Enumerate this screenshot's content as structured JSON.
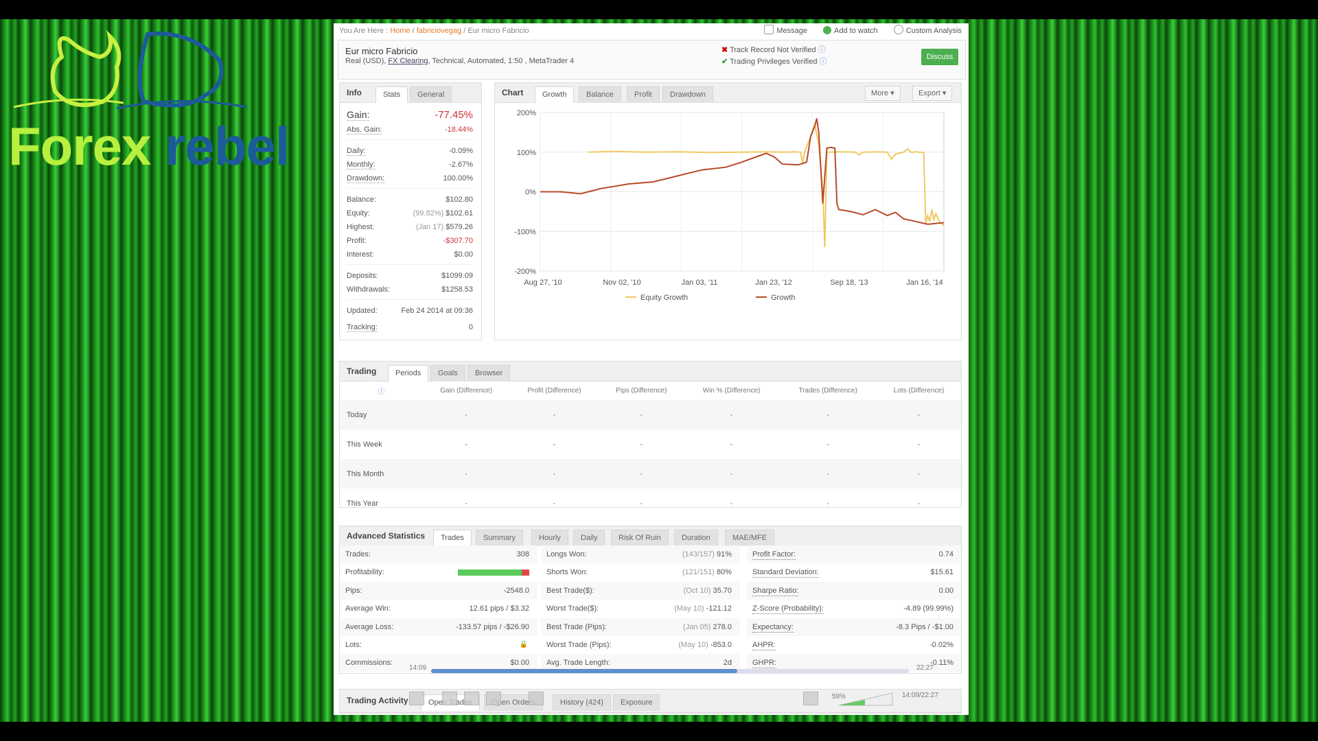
{
  "logo": {
    "word1": "Forex",
    "word2": "rebel"
  },
  "breadcrumb": {
    "prefix": "You Are Here :",
    "home": "Home",
    "user": "fabriciovegag",
    "current": "Eur micro Fabricio",
    "sep": "/"
  },
  "top_actions": {
    "message": "Message",
    "watch": "Add to watch",
    "custom": "Custom Analysis"
  },
  "account": {
    "name": "Eur micro Fabricio",
    "sub_a": "Real (USD),",
    "broker": "FX Clearing",
    "sub_b": ", Technical, Automated, 1:50 , MetaTrader 4",
    "track_record": "Track Record Not Verified",
    "privileges": "Trading Privileges Verified",
    "discuss": "Discuss"
  },
  "info_panel": {
    "tabs": [
      "Info",
      "Stats",
      "General"
    ],
    "gain_label": "Gain:",
    "gain_value": "-77.45%",
    "abs_gain_label": "Abs. Gain:",
    "abs_gain_value": "-18.44%",
    "daily_label": "Daily:",
    "daily_value": "-0.09%",
    "monthly_label": "Monthly:",
    "monthly_value": "-2.67%",
    "drawdown_label": "Drawdown:",
    "drawdown_value": "100.00%",
    "balance_label": "Balance:",
    "balance_value": "$102.80",
    "equity_label": "Equity:",
    "equity_pct": "(99.82%)",
    "equity_value": "$102.61",
    "highest_label": "Highest:",
    "highest_date": "(Jan 17)",
    "highest_value": "$579.26",
    "profit_label": "Profit:",
    "profit_value": "-$307.70",
    "interest_label": "Interest:",
    "interest_value": "$0.00",
    "deposits_label": "Deposits:",
    "deposits_value": "$1099.09",
    "withdrawals_label": "Withdrawals:",
    "withdrawals_value": "$1258.53",
    "updated_label": "Updated:",
    "updated_value": "Feb 24 2014 at 09:36",
    "tracking_label": "Tracking:",
    "tracking_value": "0"
  },
  "chart_panel": {
    "title": "Chart",
    "tabs": [
      "Growth",
      "Balance",
      "Profit",
      "Drawdown"
    ],
    "more": "More",
    "export": "Export"
  },
  "chart_data": {
    "type": "line",
    "ylim": [
      -200,
      200
    ],
    "y_ticks": [
      "200%",
      "100%",
      "0%",
      "-100%",
      "-200%"
    ],
    "x_ticks": [
      "Aug 27, '10",
      "Nov 02, '10",
      "Jan 03, '11",
      "Jan 23, '12",
      "Sep 18, '13",
      "Jan 16, '14"
    ],
    "grid": true,
    "legend_position": "bottom",
    "series": [
      {
        "name": "Equity Growth",
        "color": "#f0c860",
        "points": [
          [
            0.12,
            100
          ],
          [
            0.18,
            102
          ],
          [
            0.26,
            100
          ],
          [
            0.34,
            101
          ],
          [
            0.42,
            99
          ],
          [
            0.5,
            100
          ],
          [
            0.56,
            101
          ],
          [
            0.6,
            100
          ],
          [
            0.63,
            101
          ],
          [
            0.645,
            100
          ],
          [
            0.65,
            72
          ],
          [
            0.655,
            100
          ],
          [
            0.67,
            140
          ],
          [
            0.68,
            170
          ],
          [
            0.69,
            120
          ],
          [
            0.7,
            0
          ],
          [
            0.705,
            -140
          ],
          [
            0.71,
            100
          ],
          [
            0.75,
            101
          ],
          [
            0.78,
            100
          ],
          [
            0.79,
            93
          ],
          [
            0.8,
            100
          ],
          [
            0.83,
            101
          ],
          [
            0.86,
            100
          ],
          [
            0.87,
            82
          ],
          [
            0.88,
            95
          ],
          [
            0.9,
            100
          ],
          [
            0.91,
            108
          ],
          [
            0.92,
            99
          ],
          [
            0.93,
            101
          ],
          [
            0.95,
            99
          ],
          [
            0.955,
            -80
          ],
          [
            0.96,
            -60
          ],
          [
            0.965,
            -75
          ],
          [
            0.97,
            -45
          ],
          [
            0.975,
            -70
          ],
          [
            0.98,
            -55
          ],
          [
            0.99,
            -78
          ],
          [
            1.0,
            -85
          ]
        ]
      },
      {
        "name": "Growth",
        "color": "#b84a28",
        "points": [
          [
            0.0,
            0
          ],
          [
            0.05,
            0
          ],
          [
            0.1,
            -5
          ],
          [
            0.15,
            8
          ],
          [
            0.22,
            20
          ],
          [
            0.28,
            25
          ],
          [
            0.34,
            40
          ],
          [
            0.4,
            55
          ],
          [
            0.46,
            62
          ],
          [
            0.5,
            75
          ],
          [
            0.54,
            90
          ],
          [
            0.56,
            97
          ],
          [
            0.58,
            88
          ],
          [
            0.6,
            70
          ],
          [
            0.64,
            68
          ],
          [
            0.66,
            75
          ],
          [
            0.67,
            140
          ],
          [
            0.68,
            165
          ],
          [
            0.685,
            185
          ],
          [
            0.69,
            150
          ],
          [
            0.7,
            -30
          ],
          [
            0.71,
            110
          ],
          [
            0.72,
            112
          ],
          [
            0.73,
            110
          ],
          [
            0.735,
            -30
          ],
          [
            0.74,
            -45
          ],
          [
            0.77,
            -50
          ],
          [
            0.8,
            -58
          ],
          [
            0.83,
            -45
          ],
          [
            0.86,
            -60
          ],
          [
            0.88,
            -52
          ],
          [
            0.9,
            -68
          ],
          [
            0.93,
            -75
          ],
          [
            0.96,
            -82
          ],
          [
            1.0,
            -78
          ]
        ]
      }
    ]
  },
  "trading": {
    "title": "Trading",
    "tabs": [
      "Periods",
      "Goals",
      "Browser"
    ],
    "headers": [
      "Gain (Difference)",
      "Profit (Difference)",
      "Pips (Difference)",
      "Win % (Difference)",
      "Trades (Difference)",
      "Lots (Difference)"
    ],
    "rows": [
      {
        "label": "Today",
        "cells": [
          "-",
          "-",
          "-",
          "-",
          "-",
          "-"
        ]
      },
      {
        "label": "This Week",
        "cells": [
          "-",
          "-",
          "-",
          "-",
          "-",
          "-"
        ]
      },
      {
        "label": "This Month",
        "cells": [
          "-",
          "-",
          "-",
          "-",
          "-",
          "-"
        ]
      },
      {
        "label": "This Year",
        "cells": [
          "-",
          "-",
          "-",
          "-",
          "-",
          "-"
        ]
      }
    ]
  },
  "advanced": {
    "title": "Advanced Statistics",
    "tabs": [
      "Trades",
      "Summary",
      "Hourly",
      "Daily",
      "Risk Of Ruin",
      "Duration",
      "MAE/MFE"
    ],
    "col1": [
      {
        "k": "Trades:",
        "v": "308"
      },
      {
        "k": "Profitability:",
        "v": ""
      },
      {
        "k": "Pips:",
        "v": "-2548.0"
      },
      {
        "k": "Average Win:",
        "v": "12.61 pips / $3.32"
      },
      {
        "k": "Average Loss:",
        "v": "-133.57 pips / -$26.90"
      },
      {
        "k": "Lots:",
        "v": ""
      },
      {
        "k": "Commissions:",
        "v": "$0.00"
      }
    ],
    "profitability_pct": 89.0,
    "col2": [
      {
        "k": "Longs Won:",
        "d": "(143/157)",
        "v": "91%"
      },
      {
        "k": "Shorts Won:",
        "d": "(121/151)",
        "v": "80%"
      },
      {
        "k": "Best Trade($):",
        "d": "(Oct 10)",
        "v": "35.70"
      },
      {
        "k": "Worst Trade($):",
        "d": "(May 10)",
        "v": "-121.12"
      },
      {
        "k": "Best Trade (Pips):",
        "d": "(Jan 05)",
        "v": "278.0"
      },
      {
        "k": "Worst Trade (Pips):",
        "d": "(May 10)",
        "v": "-853.0"
      },
      {
        "k": "Avg. Trade Length:",
        "d": "",
        "v": "2d"
      }
    ],
    "col3": [
      {
        "k": "Profit Factor:",
        "v": "0.74"
      },
      {
        "k": "Standard Deviation:",
        "v": "$15.61"
      },
      {
        "k": "Sharpe Ratio:",
        "v": "0.00"
      },
      {
        "k": "Z-Score (Probability):",
        "v": "-4.89 (99.99%)"
      },
      {
        "k": "Expectancy:",
        "v": "-8.3 Pips / -$1.00"
      },
      {
        "k": "AHPR:",
        "v": "-0.02%"
      },
      {
        "k": "GHPR:",
        "v": "-0.11%"
      }
    ]
  },
  "activity": {
    "title": "Trading Activity",
    "tabs": [
      "Open Trades",
      "Open Orders",
      "History (424)",
      "Exposure"
    ]
  },
  "video": {
    "start": "14:09",
    "end": "22:27",
    "time": "14:09/22:27",
    "progress": 0.63,
    "volume": "59%"
  },
  "colors": {
    "accent_green": "#4caf50",
    "negative": "#d0303a",
    "link": "#e07a2c"
  }
}
